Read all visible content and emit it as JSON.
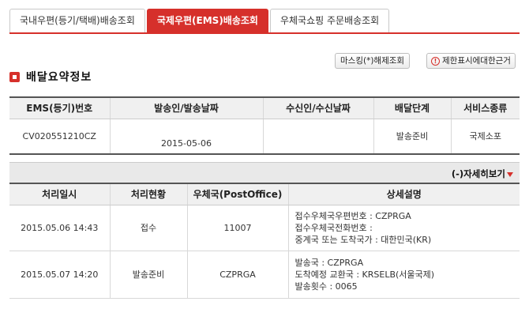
{
  "tabs": [
    {
      "label": "국내우편(등기/택배)배송조회"
    },
    {
      "label": "국제우편(EMS)배송조회"
    },
    {
      "label": "우체국쇼핑 주문배송조회"
    }
  ],
  "actions": {
    "mask_label": "마스킹(*)해제조회",
    "help_label": "제한표시에대한근거"
  },
  "section_title": "배달요약정보",
  "summary": {
    "headers": [
      "EMS(등기)번호",
      "발송인/발송날짜",
      "수신인/수신날짜",
      "배달단계",
      "서비스종류"
    ],
    "row": {
      "tracking_no": "CV020551210CZ",
      "sender_date": "2015-05-06",
      "receiver_date": "",
      "stage": "발송준비",
      "service": "국제소포"
    }
  },
  "detail_toggle": "(-)자세히보기",
  "details": {
    "headers": [
      "처리일시",
      "처리현황",
      "우체국(PostOffice)",
      "상세설명"
    ],
    "rows": [
      {
        "datetime": "2015.05.06 14:43",
        "status": "접수",
        "office": "11007",
        "desc": [
          "접수우체국우편번호 : CZPRGA",
          "접수우체국전화번호 :",
          "중계국 또는 도착국가 : 대한민국(KR)"
        ]
      },
      {
        "datetime": "2015.05.07 14:20",
        "status": "발송준비",
        "office": "CZPRGA",
        "desc": [
          "발송국 : CZPRGA",
          "도착예정 교환국 : KRSELB(서울국제)",
          "발송횟수 : 0065"
        ]
      }
    ]
  }
}
